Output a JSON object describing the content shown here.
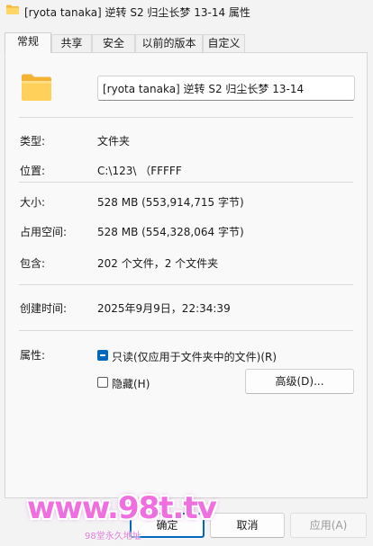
{
  "window": {
    "title": "[ryota tanaka] 逆转 S2 归尘长梦 13-14 属性"
  },
  "tabs": [
    {
      "label": "常规",
      "active": true
    },
    {
      "label": "共享"
    },
    {
      "label": "安全"
    },
    {
      "label": "以前的版本"
    },
    {
      "label": "自定义"
    }
  ],
  "general": {
    "folder_name": "[ryota tanaka] 逆转 S2 归尘长梦 13-14",
    "type_label": "类型:",
    "type_value": "文件夹",
    "location_label": "位置:",
    "location_value": "C:\\123\\ （FFFFF",
    "size_label": "大小:",
    "size_value": "528 MB (553,914,715 字节)",
    "size_on_disk_label": "占用空间:",
    "size_on_disk_value": "528 MB (554,328,064 字节)",
    "contains_label": "包含:",
    "contains_value": "202 个文件，2 个文件夹",
    "created_label": "创建时间:",
    "created_value": "2025年9月9日，22:34:39",
    "attributes_label": "属性:",
    "readonly_label": "只读(仅应用于文件夹中的文件)(R)",
    "readonly_state": "indeterminate",
    "hidden_label": "隐藏(H)",
    "hidden_checked": false,
    "advanced_button": "高级(D)..."
  },
  "footer": {
    "ok": "确定",
    "cancel": "取消",
    "apply": "应用(A)"
  },
  "watermark": {
    "text": "www.98t.tv",
    "subtext": "98堂永久地址"
  },
  "colors": {
    "accent": "#0067c0",
    "folder": "#f7c94a",
    "watermark": "#f06fe0"
  }
}
